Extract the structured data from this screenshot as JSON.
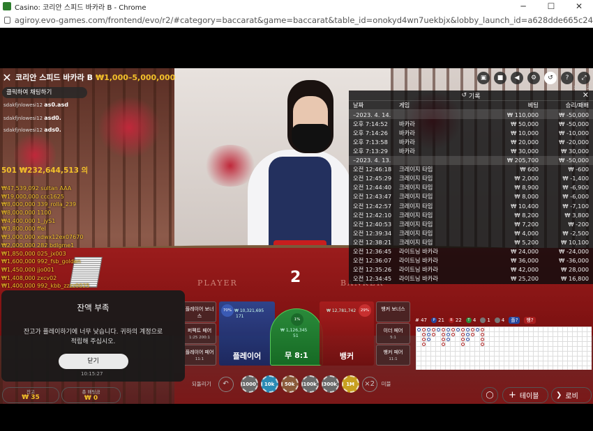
{
  "browser": {
    "title": "Casino: 코리안 스피드 바카라 B - Chrome",
    "url": "agiroy.evo-games.com/frontend/evo/r2/#category=baccarat&game=baccarat&table_id=onokyd4wn7uekbjx&lobby_launch_id=a628dde665c24889a5f8342433091d72"
  },
  "game": {
    "title": "코리안 스피드 바카라 B",
    "limit": "₩1,000–5,000,000",
    "chat_button": "클릭하여 채팅하기",
    "chat": [
      {
        "user": "sdakfjnlowesi12",
        "msg": "as0.asd"
      },
      {
        "user": "sdakfjnlowesi12",
        "msg": "asd0."
      },
      {
        "user": "sdakfjnlowesi12",
        "msg": "ads0."
      }
    ],
    "players_count": "501 ₩232,644,513 의",
    "count_display": "2",
    "clock": "10:15:27",
    "table_player": "PLAYER",
    "table_banker": "BANKER"
  },
  "winners": [
    "₩47,539,092 sultan AAA",
    "₩19,000,000 ccc1625",
    "₩8,000,000 339_rolla_239",
    "₩8,000,000 1100",
    "₩4,400,000 1_jyS1",
    "₩3,800,000 ffel",
    "₩3,000,000 xdwx12ex07670",
    "₩2,000,000 282 bdlgme1",
    "₩1,850,000 025_jx003",
    "₩1,600,000 992_fsb_golden",
    "₩1,450,000 jjo001",
    "₩1,408,000 zxcv02",
    "₩1,400,000 992_kbb_zzzz0025"
  ],
  "history": {
    "title": "기록",
    "columns": [
      "날짜",
      "게임",
      "베팅",
      "승리/패배"
    ],
    "rows": [
      {
        "type": "group",
        "date": "–2023. 4. 14.",
        "game": "",
        "bet": "₩ 110,000",
        "result": "₩ -50,000"
      },
      {
        "type": "row",
        "date": "오후 7:14:52",
        "game": "바카라",
        "bet": "₩ 50,000",
        "result": "₩ -50,000"
      },
      {
        "type": "row",
        "date": "오후 7:14:26",
        "game": "바카라",
        "bet": "₩ 10,000",
        "result": "₩ -10,000"
      },
      {
        "type": "row",
        "date": "오후 7:13:58",
        "game": "바카라",
        "bet": "₩ 20,000",
        "result": "₩ -20,000"
      },
      {
        "type": "row",
        "date": "오후 7:13:29",
        "game": "바카라",
        "bet": "₩ 30,000",
        "result": "₩ 30,000"
      },
      {
        "type": "group",
        "date": "–2023. 4. 13.",
        "game": "",
        "bet": "₩ 205,700",
        "result": "₩ -50,000"
      },
      {
        "type": "row",
        "date": "오전 12:46:18",
        "game": "크레이지 타임",
        "bet": "₩ 600",
        "result": "₩ -600"
      },
      {
        "type": "row",
        "date": "오전 12:45:29",
        "game": "크레이지 타임",
        "bet": "₩ 2,000",
        "result": "₩ -1,400"
      },
      {
        "type": "row",
        "date": "오전 12:44:40",
        "game": "크레이지 타임",
        "bet": "₩ 8,900",
        "result": "₩ -6,900"
      },
      {
        "type": "row",
        "date": "오전 12:43:47",
        "game": "크레이지 타임",
        "bet": "₩ 8,000",
        "result": "₩ -6,000"
      },
      {
        "type": "row",
        "date": "오전 12:42:57",
        "game": "크레이지 타임",
        "bet": "₩ 10,400",
        "result": "₩ -7,100"
      },
      {
        "type": "row",
        "date": "오전 12:42:10",
        "game": "크레이지 타임",
        "bet": "₩ 8,200",
        "result": "₩ 3,800"
      },
      {
        "type": "row",
        "date": "오전 12:40:53",
        "game": "크레이지 타임",
        "bet": "₩ 7,200",
        "result": "₩ -200"
      },
      {
        "type": "row",
        "date": "오전 12:39:34",
        "game": "크레이지 타임",
        "bet": "₩ 4,000",
        "result": "₩ -2,500"
      },
      {
        "type": "row",
        "date": "오전 12:38:21",
        "game": "크레이지 타임",
        "bet": "₩ 5,200",
        "result": "₩ 10,100"
      },
      {
        "type": "row",
        "date": "오전 12:36:45",
        "game": "라이트닝 바카라",
        "bet": "₩ 24,000",
        "result": "₩ -24,000"
      },
      {
        "type": "row",
        "date": "오전 12:36:07",
        "game": "라이트닝 바카라",
        "bet": "₩ 36,000",
        "result": "₩ -36,000"
      },
      {
        "type": "row",
        "date": "오전 12:35:26",
        "game": "라이트닝 바카라",
        "bet": "₩ 42,000",
        "result": "₩ 28,000"
      },
      {
        "type": "row",
        "date": "오전 12:34:45",
        "game": "라이트닝 바카라",
        "bet": "₩ 25,200",
        "result": "₩ 16,800"
      }
    ]
  },
  "bets": {
    "player_bonus": "플레이어 보너스",
    "perfect_pair": "퍼펙트 페어",
    "perfect_pair_odds": "1:25 200:1",
    "player_pair": "플레이어 페어",
    "player_pair_odds": "11:1",
    "player": "플레이어",
    "player_amount": "₩ 10,321,695",
    "player_people": "171",
    "player_pct": "70%",
    "tie": "무 8:1",
    "tie_amount": "₩ 1,126,345",
    "tie_people": "51",
    "tie_pct": "1%",
    "banker": "뱅커",
    "banker_amount": "₩ 12,781,742",
    "banker_pct": "29%",
    "banker_bonus": "뱅커 보너스",
    "either_pair": "이더 페어",
    "either_pair_odds": "5:1",
    "banker_pair": "뱅커 페어",
    "banker_pair_odds": "11:1"
  },
  "stats": {
    "total": "# 47",
    "player_wins": "21",
    "banker_wins": "22",
    "ties": "4",
    "player_pairs": "1",
    "banker_pairs": "4",
    "player_next": "플?",
    "banker_next": "뱅?"
  },
  "modal": {
    "title": "잔액 부족",
    "message": "잔고가 플레이하기에 너무 낮습니다. 귀하의 계정으로 적립해 주십시오.",
    "button": "닫기",
    "time": "10:15:27"
  },
  "chips": {
    "undo_label": "되돌리기",
    "values": [
      "1000",
      "10k",
      "50k",
      "100k",
      "300k",
      "1M"
    ],
    "double_label": "미블"
  },
  "footer": {
    "balance_label": "잔고",
    "balance": "₩ 35",
    "total_bet_label": "총 배팅금",
    "total_bet": "₩ 0",
    "table_button": "테이블",
    "lobby_button": "로비"
  },
  "colors": {
    "gold": "#f3c12a",
    "player": "#2648a0",
    "banker": "#aa1e1e",
    "tie": "#2a8a3a"
  }
}
